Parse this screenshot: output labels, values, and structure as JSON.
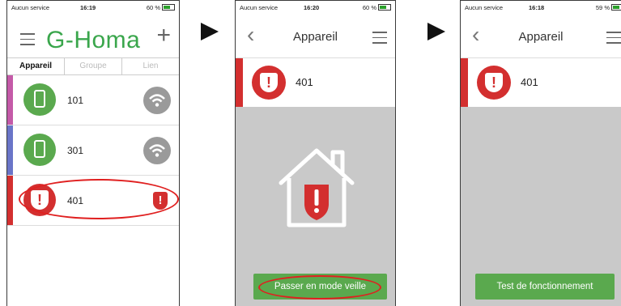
{
  "screens": [
    {
      "status": {
        "carrier": "Aucun service",
        "time": "16:19",
        "battery": "60 %"
      },
      "app_logo": "G-Homa",
      "tabs": [
        {
          "label": "Appareil"
        },
        {
          "label": "Groupe"
        },
        {
          "label": "Lien"
        }
      ],
      "devices": [
        {
          "name": "101",
          "stripe_color": "#c45aa8",
          "icon": "plug-icon",
          "status_icon": "wifi-icon"
        },
        {
          "name": "301",
          "stripe_color": "#6a75c8",
          "icon": "plug-icon",
          "status_icon": "wifi-icon"
        },
        {
          "name": "401",
          "stripe_color": "#d32f2f",
          "icon": "alert-shield-icon",
          "status_icon": "alert-shield-icon"
        }
      ]
    },
    {
      "status": {
        "carrier": "Aucun service",
        "time": "16:20",
        "battery": "60 %"
      },
      "title": "Appareil",
      "device": {
        "name": "401"
      },
      "illustration": "house-alert-icon",
      "button_label": "Passer en mode veille"
    },
    {
      "status": {
        "carrier": "Aucun service",
        "time": "16:18",
        "battery": "59 %"
      },
      "title": "Appareil",
      "device": {
        "name": "401"
      },
      "button_label": "Test de fonctionnement"
    }
  ],
  "colors": {
    "brand_green": "#3aa64c",
    "button_green": "#5aa94e",
    "alert_red": "#d32f2f",
    "highlight": "#e02020"
  }
}
